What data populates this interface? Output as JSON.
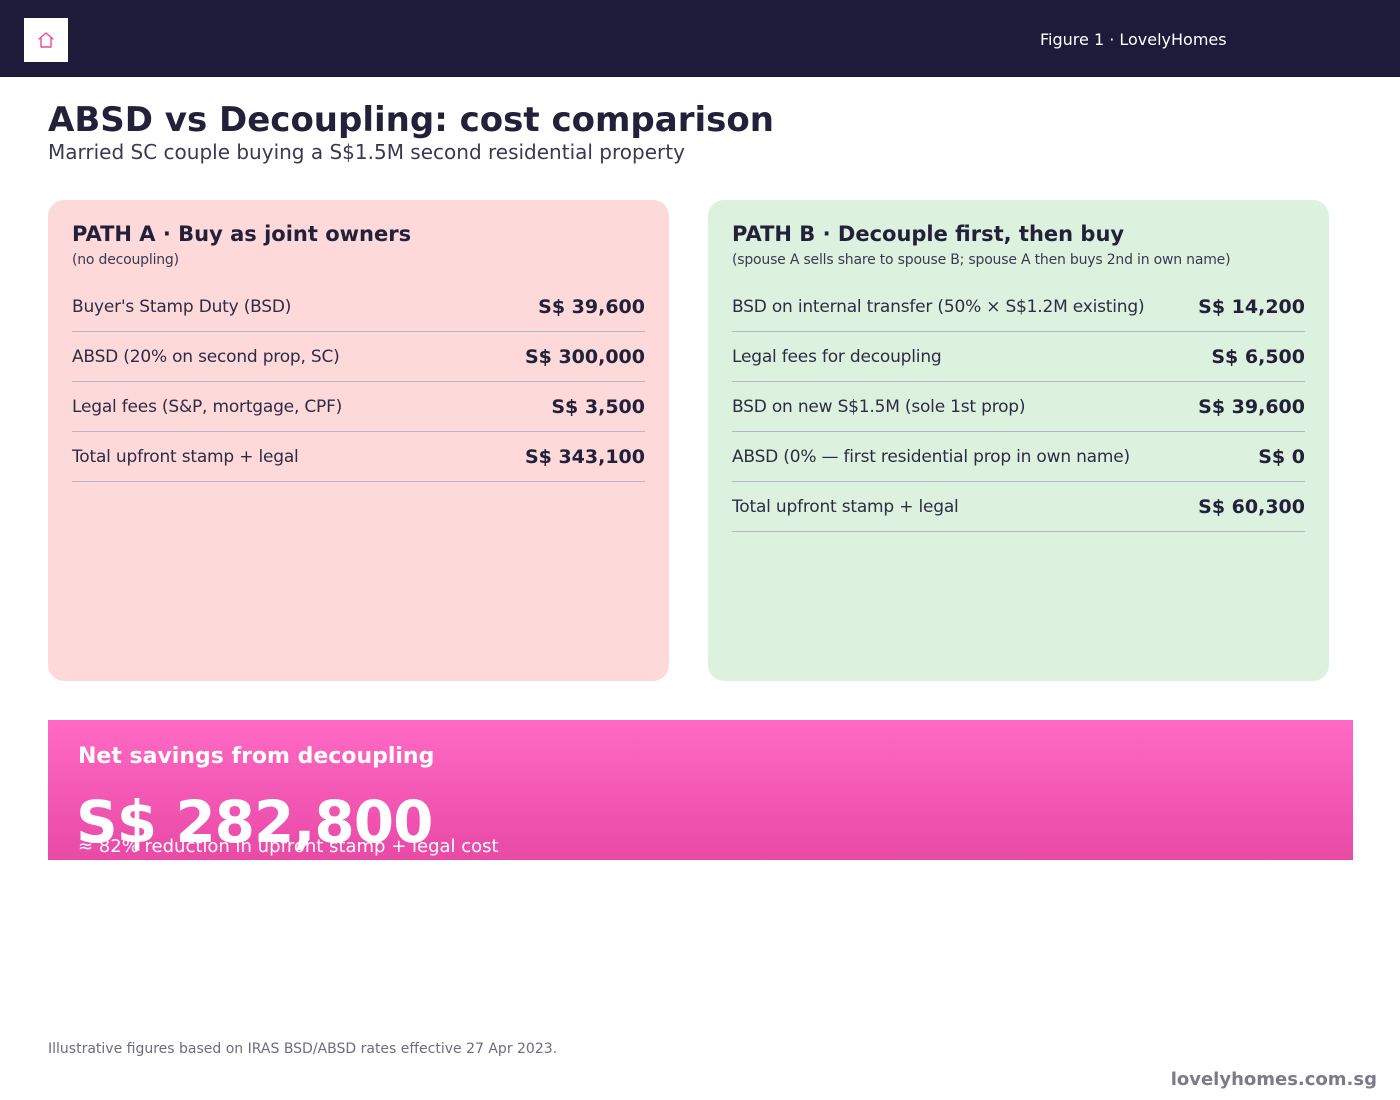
{
  "header": {
    "logo_icon": "home-icon",
    "figure_label": "Figure 1 · LovelyHomes",
    "colors": {
      "bar": "#1e1b3a",
      "logo_accent": "#e84aa6"
    }
  },
  "page": {
    "title": "ABSD vs Decoupling: cost comparison",
    "subtitle": "Married SC couple buying a S$1.5M second residential property"
  },
  "path_a": {
    "title": "PATH A · Buy as joint owners",
    "note": "(no decoupling)",
    "background": "#fdd9da",
    "rows": [
      {
        "label": "Buyer's Stamp Duty (BSD)",
        "value": "S$ 39,600"
      },
      {
        "label": "ABSD (20% on second prop, SC)",
        "value": "S$ 300,000"
      },
      {
        "label": "Legal fees (S&P, mortgage, CPF)",
        "value": "S$ 3,500"
      },
      {
        "label": "Total upfront stamp + legal",
        "value": "S$ 343,100"
      }
    ]
  },
  "path_b": {
    "title": "PATH B · Decouple first, then buy",
    "note": "(spouse A sells share to spouse B; spouse A then buys 2nd in own name)",
    "background": "#dcf2de",
    "rows": [
      {
        "label": "BSD on internal transfer (50% × S$1.2M existing)",
        "value": "S$ 14,200"
      },
      {
        "label": "Legal fees for decoupling",
        "value": "S$ 6,500"
      },
      {
        "label": "BSD on new S$1.5M (sole 1st prop)",
        "value": "S$ 39,600"
      },
      {
        "label": "ABSD (0% — first residential prop in own name)",
        "value": "S$ 0"
      },
      {
        "label": "Total upfront stamp + legal",
        "value": "S$ 60,300"
      }
    ]
  },
  "savings": {
    "title": "Net savings from decoupling",
    "amount": "S$ 282,800",
    "note": "≈ 82% reduction in upfront stamp + legal cost",
    "colors": {
      "top": "#ff69c4",
      "bottom": "#e84aa6"
    }
  },
  "footer": {
    "footnote": "Illustrative figures based on IRAS BSD/ABSD rates effective 27 Apr 2023.",
    "site": "lovelyhomes.com.sg"
  }
}
